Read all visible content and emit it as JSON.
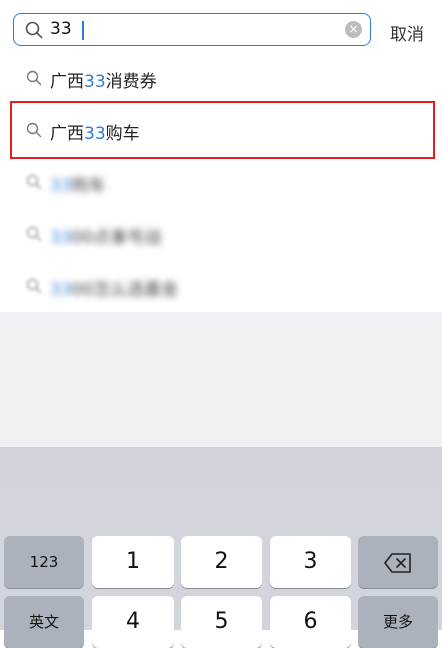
{
  "search": {
    "value": "33",
    "cancel_label": "取消"
  },
  "suggestions": [
    {
      "prefix": "广西",
      "highlight": "33",
      "suffix": "消费券",
      "selected": false,
      "blurred": false
    },
    {
      "prefix": "广西",
      "highlight": "33",
      "suffix": "购车",
      "selected": true,
      "blurred": false
    },
    {
      "prefix": "",
      "highlight": "33",
      "suffix": "购车",
      "selected": false,
      "blurred": true
    },
    {
      "prefix": "",
      "highlight": "33",
      "suffix": "00点事号战",
      "selected": false,
      "blurred": true
    },
    {
      "prefix": "",
      "highlight": "33",
      "suffix": "00怎么选基金",
      "selected": false,
      "blurred": true
    }
  ],
  "keyboard": {
    "row1": {
      "left": "123",
      "k1": "1",
      "k2": "2",
      "k3": "3",
      "backspace_icon": "backspace-icon"
    },
    "row2": {
      "left": "英文",
      "k1": "4",
      "k2": "5",
      "k3": "6",
      "right": "更多"
    }
  },
  "colors": {
    "accent": "#2e7bd6",
    "highlight_border": "#e02020",
    "keyboard_bg": "#d2d5db"
  }
}
